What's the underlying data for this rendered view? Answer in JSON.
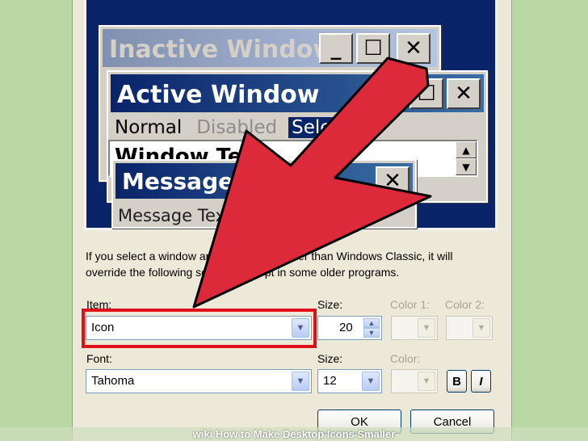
{
  "preview": {
    "inactive_window": {
      "title": "Inactive Window",
      "min_glyph": "_",
      "max_glyph": "☐",
      "close_glyph": "✕"
    },
    "active_window": {
      "title": "Active Window",
      "max_glyph": "☐",
      "close_glyph": "✕"
    },
    "menu": {
      "normal": "Normal",
      "disabled": "Disabled",
      "selected": "Selected"
    },
    "window_text": "Window Text",
    "message_box": {
      "title": "Message Box",
      "close_glyph": "✕",
      "text": "Message Text"
    }
  },
  "info_text": "If you select a window and button style other than Windows Classic, it will override the following settings, except in some older programs.",
  "item": {
    "label": "Item:",
    "value": "Icon"
  },
  "item_size": {
    "label": "Size:",
    "value": "20"
  },
  "color1": {
    "label": "Color 1:"
  },
  "color2": {
    "label": "Color 2:"
  },
  "font": {
    "label": "Font:",
    "value": "Tahoma"
  },
  "font_size": {
    "label": "Size:",
    "value": "12"
  },
  "font_color": {
    "label": "Color:"
  },
  "bold_label": "B",
  "italic_label": "I",
  "ok_label": "OK",
  "cancel_label": "Cancel",
  "footer": "wiki How to Make Desktop Icons Smaller",
  "colors": {
    "highlight": "#e0101a",
    "arrow": "#dc2a3b",
    "titlebar": "#0a246a"
  }
}
